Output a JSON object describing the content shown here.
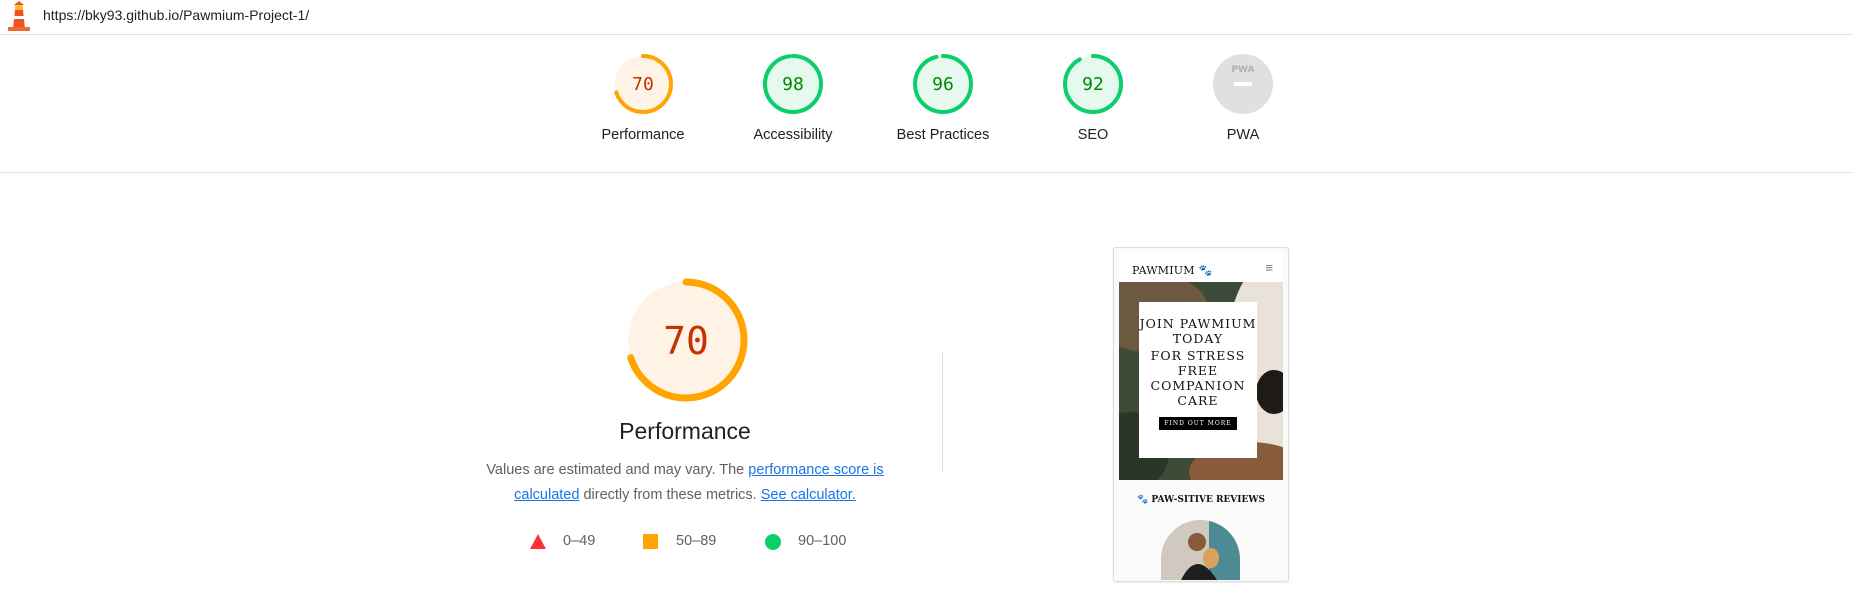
{
  "topbar": {
    "logo_icon": "lighthouse-icon",
    "url": "https://bky93.github.io/Pawmium-Project-1/"
  },
  "categories": [
    {
      "id": "performance",
      "label": "Performance",
      "score": "70",
      "fraction": 0.7,
      "color": "#ffa400",
      "fill": "#fff3e6",
      "text_color": "#c33300"
    },
    {
      "id": "accessibility",
      "label": "Accessibility",
      "score": "98",
      "fraction": 0.98,
      "color": "#0cce6b",
      "fill": "#e6f9ef",
      "text_color": "#008800"
    },
    {
      "id": "best-practices",
      "label": "Best Practices",
      "score": "96",
      "fraction": 0.96,
      "color": "#0cce6b",
      "fill": "#e6f9ef",
      "text_color": "#008800"
    },
    {
      "id": "seo",
      "label": "SEO",
      "score": "92",
      "fraction": 0.92,
      "color": "#0cce6b",
      "fill": "#e6f9ef",
      "text_color": "#008800"
    },
    {
      "id": "pwa",
      "label": "PWA",
      "badge_text": "PWA",
      "icon": "pwa-badge-icon",
      "color": "#e0e0e0"
    }
  ],
  "performance": {
    "score": "70",
    "fraction": 0.7,
    "title": "Performance",
    "desc_prefix": "Values are estimated and may vary. The ",
    "link_score": "performance score is calculated",
    "desc_middle": " directly from these metrics. ",
    "link_calculator": "See calculator."
  },
  "legend": [
    {
      "range": "0–49",
      "shape": "triangle",
      "color": "#ff3333"
    },
    {
      "range": "50–89",
      "shape": "square",
      "color": "#ffa400"
    },
    {
      "range": "90–100",
      "shape": "circle",
      "color": "#0cce6b"
    }
  ],
  "preview": {
    "brand": "PAWMIUM",
    "brand_icon": "paw-icon",
    "menu_icon": "hamburger-menu-icon",
    "hero_lines_1": "JOIN PAWMIUM TODAY",
    "hero_lines_2": "FOR STRESS FREE COMPANION CARE",
    "hero_button": "FIND OUT MORE",
    "reviews_heading": "PAW-SITIVE REVIEWS"
  }
}
